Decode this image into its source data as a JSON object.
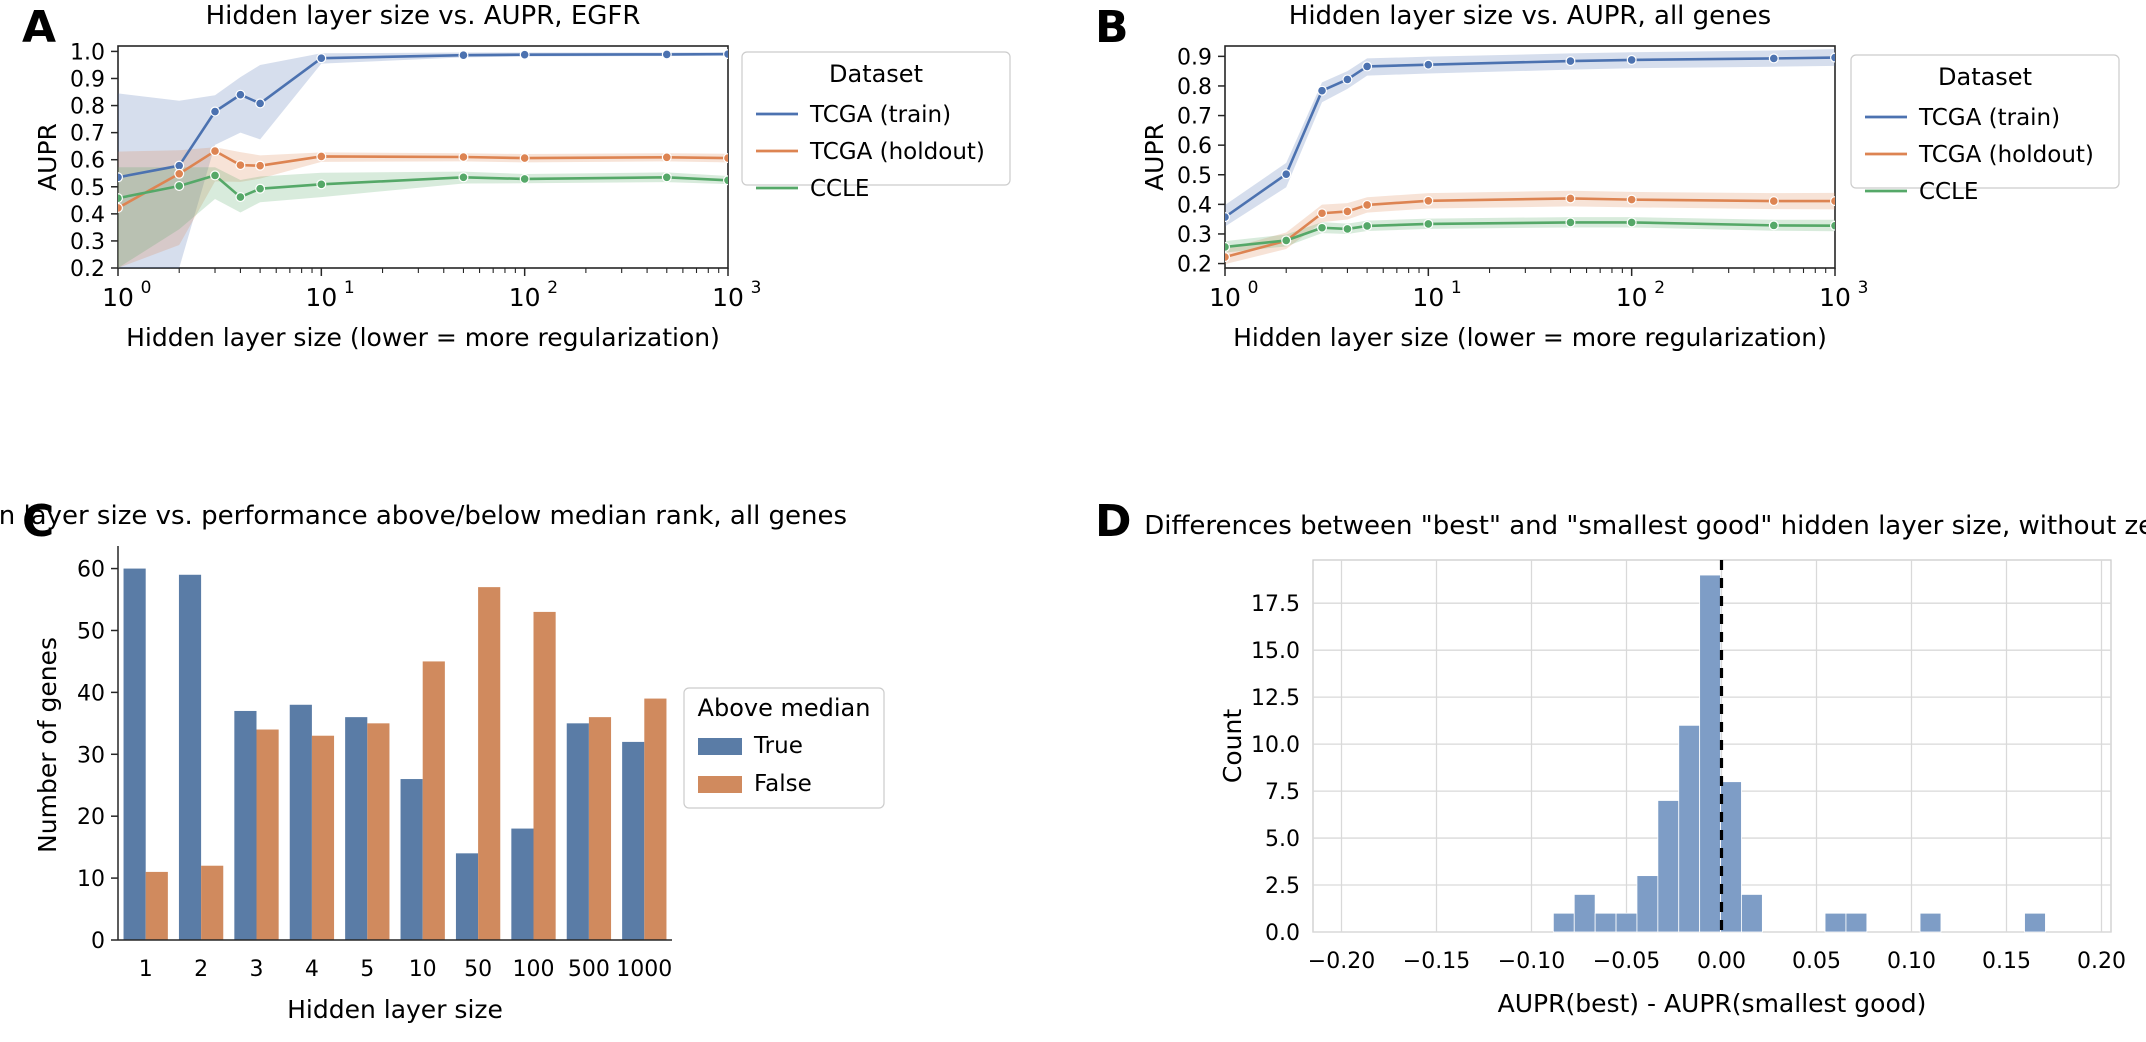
{
  "figure": {
    "panels": [
      "A",
      "B",
      "C",
      "D"
    ],
    "colors": {
      "tcga_train": "#4c72b0",
      "tcga_holdout": "#dd8452",
      "ccle": "#55a868",
      "bar_true": "#5a7ca6",
      "bar_false": "#d08a5e",
      "hist_bar": "#7e9dc6",
      "axis": "#262626",
      "grid": "#d9d9d9"
    }
  },
  "panelA": {
    "letter": "A",
    "title": "Hidden layer size vs. AUPR, EGFR",
    "xlabel": "Hidden layer size (lower = more regularization)",
    "ylabel": "AUPR",
    "legend_title": "Dataset",
    "xticks": [
      "10^0",
      "10^1",
      "10^2",
      "10^3"
    ],
    "yticks": [
      "0.2",
      "0.3",
      "0.4",
      "0.5",
      "0.6",
      "0.7",
      "0.8",
      "0.9",
      "1.0"
    ],
    "chart_data": {
      "type": "line",
      "title": "Hidden layer size vs. AUPR, EGFR",
      "xlabel": "Hidden layer size (lower = more regularization)",
      "ylabel": "AUPR",
      "xscale": "log",
      "xlim": [
        1,
        1000
      ],
      "ylim": [
        0.2,
        1.02
      ],
      "grid": false,
      "legend_position": "right",
      "x": [
        1,
        2,
        3,
        4,
        5,
        10,
        50,
        100,
        500,
        1000
      ],
      "series": [
        {
          "name": "TCGA (train)",
          "color": "#4c72b0",
          "values": [
            0.535,
            0.578,
            0.778,
            0.84,
            0.808,
            0.975,
            0.986,
            0.988,
            0.989,
            0.99
          ],
          "lower": [
            0.2,
            0.2,
            0.655,
            0.7,
            0.675,
            0.955,
            0.978,
            0.981,
            0.983,
            0.984
          ],
          "upper": [
            0.845,
            0.818,
            0.838,
            0.905,
            0.95,
            0.993,
            0.996,
            0.996,
            0.996,
            0.997
          ]
        },
        {
          "name": "TCGA (holdout)",
          "color": "#dd8452",
          "values": [
            0.422,
            0.548,
            0.632,
            0.58,
            0.578,
            0.612,
            0.61,
            0.606,
            0.609,
            0.606
          ],
          "lower": [
            0.2,
            0.285,
            0.52,
            0.518,
            0.53,
            0.592,
            0.594,
            0.59,
            0.594,
            0.59
          ],
          "upper": [
            0.63,
            0.635,
            0.646,
            0.628,
            0.616,
            0.627,
            0.624,
            0.621,
            0.624,
            0.622
          ]
        },
        {
          "name": "CCLE",
          "color": "#55a868",
          "values": [
            0.458,
            0.503,
            0.542,
            0.462,
            0.493,
            0.509,
            0.535,
            0.529,
            0.535,
            0.524
          ],
          "lower": [
            0.2,
            0.343,
            0.455,
            0.405,
            0.443,
            0.462,
            0.512,
            0.513,
            0.517,
            0.51
          ],
          "upper": [
            0.572,
            0.572,
            0.572,
            0.525,
            0.538,
            0.552,
            0.556,
            0.547,
            0.553,
            0.54
          ]
        }
      ]
    }
  },
  "panelB": {
    "letter": "B",
    "title": "Hidden layer size vs. AUPR, all genes",
    "xlabel": "Hidden layer size (lower = more regularization)",
    "ylabel": "AUPR",
    "legend_title": "Dataset",
    "xticks": [
      "10^0",
      "10^1",
      "10^2",
      "10^3"
    ],
    "yticks": [
      "0.2",
      "0.3",
      "0.4",
      "0.5",
      "0.6",
      "0.7",
      "0.8",
      "0.9"
    ],
    "chart_data": {
      "type": "line",
      "title": "Hidden layer size vs. AUPR, all genes",
      "xlabel": "Hidden layer size (lower = more regularization)",
      "ylabel": "AUPR",
      "xscale": "log",
      "xlim": [
        1,
        1000
      ],
      "ylim": [
        0.185,
        0.935
      ],
      "grid": false,
      "legend_position": "right",
      "x": [
        1,
        2,
        3,
        4,
        5,
        10,
        50,
        100,
        500,
        1000
      ],
      "series": [
        {
          "name": "TCGA (train)",
          "color": "#4c72b0",
          "values": [
            0.357,
            0.502,
            0.784,
            0.822,
            0.866,
            0.872,
            0.884,
            0.888,
            0.893,
            0.896
          ],
          "lower": [
            0.325,
            0.458,
            0.745,
            0.79,
            0.835,
            0.842,
            0.855,
            0.86,
            0.865,
            0.868
          ],
          "upper": [
            0.398,
            0.54,
            0.812,
            0.85,
            0.893,
            0.899,
            0.91,
            0.914,
            0.92,
            0.925
          ]
        },
        {
          "name": "TCGA (holdout)",
          "color": "#dd8452",
          "values": [
            0.222,
            0.277,
            0.37,
            0.376,
            0.398,
            0.412,
            0.42,
            0.416,
            0.411,
            0.411
          ],
          "lower": [
            0.198,
            0.249,
            0.34,
            0.349,
            0.372,
            0.386,
            0.393,
            0.39,
            0.384,
            0.383
          ],
          "upper": [
            0.248,
            0.305,
            0.399,
            0.404,
            0.424,
            0.438,
            0.446,
            0.442,
            0.438,
            0.439
          ]
        },
        {
          "name": "CCLE",
          "color": "#55a868",
          "values": [
            0.256,
            0.278,
            0.321,
            0.317,
            0.327,
            0.334,
            0.339,
            0.339,
            0.329,
            0.328
          ],
          "lower": [
            0.237,
            0.258,
            0.303,
            0.3,
            0.31,
            0.317,
            0.322,
            0.322,
            0.311,
            0.309
          ],
          "upper": [
            0.276,
            0.298,
            0.34,
            0.335,
            0.345,
            0.352,
            0.357,
            0.357,
            0.348,
            0.348
          ]
        }
      ]
    }
  },
  "panelC": {
    "letter": "C",
    "title": "Hidden layer size vs. performance above/below median rank, all genes",
    "xlabel": "Hidden layer size",
    "ylabel": "Number of genes",
    "legend_title": "Above median",
    "yticks": [
      "0",
      "10",
      "20",
      "30",
      "40",
      "50",
      "60"
    ],
    "chart_data": {
      "type": "bar",
      "title": "Hidden layer size vs. performance above/below median rank, all genes",
      "xlabel": "Hidden layer size",
      "ylabel": "Number of genes",
      "ylim": [
        0,
        63
      ],
      "grid": false,
      "legend_position": "right",
      "categories": [
        "1",
        "2",
        "3",
        "4",
        "5",
        "10",
        "50",
        "100",
        "500",
        "1000"
      ],
      "series": [
        {
          "name": "True",
          "color": "#5a7ca6",
          "values": [
            60,
            59,
            37,
            38,
            36,
            26,
            14,
            18,
            35,
            32
          ]
        },
        {
          "name": "False",
          "color": "#d08a5e",
          "values": [
            11,
            12,
            34,
            33,
            35,
            45,
            57,
            53,
            36,
            39
          ]
        }
      ]
    }
  },
  "panelD": {
    "letter": "D",
    "title": "Differences between \"best\" and \"smallest good\" hidden layer size, without zeroes",
    "xlabel": "AUPR(best) - AUPR(smallest good)",
    "ylabel": "Count",
    "xticks": [
      "-0.20",
      "-0.15",
      "-0.10",
      "-0.05",
      "0.00",
      "0.05",
      "0.10",
      "0.15",
      "0.20"
    ],
    "yticks": [
      "0.0",
      "2.5",
      "5.0",
      "7.5",
      "10.0",
      "12.5",
      "15.0",
      "17.5"
    ],
    "chart_data": {
      "type": "bar",
      "subtype": "histogram",
      "title": "Differences between \"best\" and \"smallest good\" hidden layer size, without zeroes",
      "xlabel": "AUPR(best) - AUPR(smallest good)",
      "ylabel": "Count",
      "xlim": [
        -0.215,
        0.205
      ],
      "ylim": [
        0,
        19.8
      ],
      "grid": true,
      "bin_width": 0.011,
      "reference_line": 0.0,
      "bins": [
        {
          "left": -0.0885,
          "count": 1
        },
        {
          "left": -0.0775,
          "count": 2
        },
        {
          "left": -0.0665,
          "count": 1
        },
        {
          "left": -0.0555,
          "count": 1
        },
        {
          "left": -0.0445,
          "count": 3
        },
        {
          "left": -0.0335,
          "count": 7
        },
        {
          "left": -0.0225,
          "count": 11
        },
        {
          "left": -0.0115,
          "count": 19
        },
        {
          "left": -0.0005,
          "count": 8
        },
        {
          "left": 0.0105,
          "count": 2
        },
        {
          "left": 0.0545,
          "count": 1
        },
        {
          "left": 0.0655,
          "count": 1
        },
        {
          "left": 0.1045,
          "count": 1
        },
        {
          "left": 0.1595,
          "count": 1
        }
      ]
    }
  }
}
